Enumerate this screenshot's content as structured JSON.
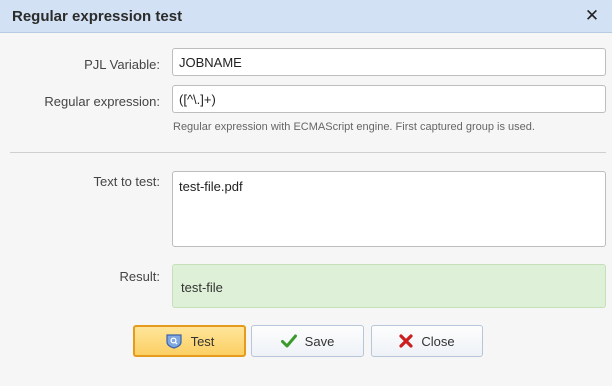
{
  "dialog": {
    "title": "Regular expression test",
    "close_glyph": "✕"
  },
  "form": {
    "pjl_label": "PJL Variable:",
    "pjl_value": "JOBNAME",
    "regex_label": "Regular expression:",
    "regex_value": "([^\\.]+)",
    "regex_hint": "Regular expression with ECMAScript engine. First captured group is used.",
    "text_label": "Text to test:",
    "text_value": "test-file.pdf",
    "result_label": "Result:",
    "result_value": "test-file"
  },
  "buttons": {
    "test": {
      "label": "Test",
      "icon": "shield-badge-icon"
    },
    "save": {
      "label": "Save",
      "icon": "checkmark-icon"
    },
    "close": {
      "label": "Close",
      "icon": "x-mark-icon"
    }
  },
  "colors": {
    "titlebar": "#d2e2f4",
    "result_bg": "#dff0d8",
    "test_button": "#fbcf63",
    "check_green": "#3a9a2b",
    "close_red": "#cc1f1f"
  }
}
